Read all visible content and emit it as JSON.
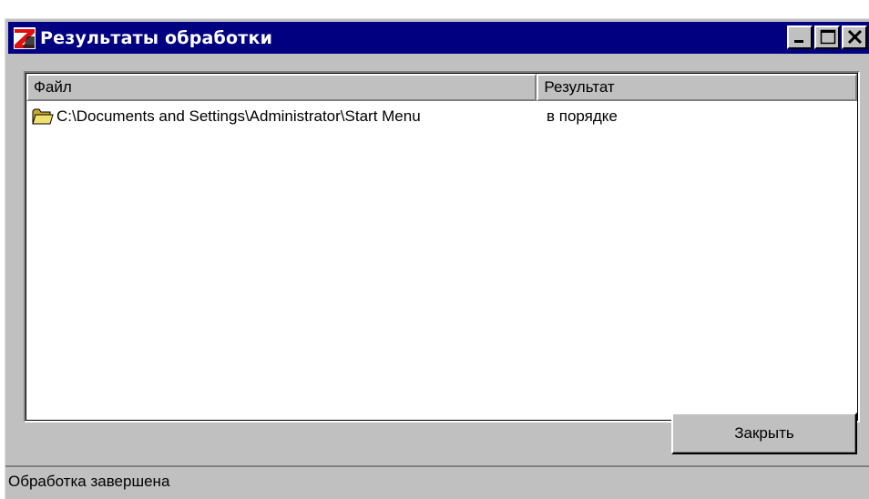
{
  "window": {
    "title": "Результаты обработки",
    "app_icon": "red-z-app-icon",
    "controls": [
      "minimize-icon",
      "maximize-icon",
      "close-icon"
    ]
  },
  "list": {
    "columns": [
      "Файл",
      "Результат"
    ],
    "rows": [
      {
        "icon": "folder-icon",
        "file": "C:\\Documents and Settings\\Administrator\\Start Menu",
        "result": "в порядке"
      }
    ]
  },
  "buttons": {
    "close_label": "Закрыть"
  },
  "statusbar": {
    "text": "Обработка завершена"
  },
  "colors": {
    "titlebar": "#000080",
    "face": "#c0c0c0",
    "list_background": "#ffffff",
    "icon_red": "#e01010",
    "folder": "#e8d060"
  }
}
